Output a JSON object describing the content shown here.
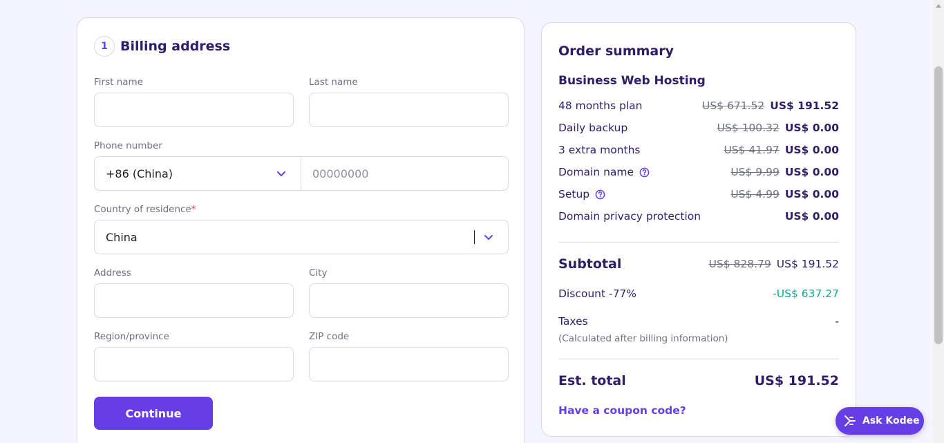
{
  "billing": {
    "step_number": "1",
    "title": "Billing address",
    "first_name": {
      "label": "First name",
      "value": ""
    },
    "last_name": {
      "label": "Last name",
      "value": ""
    },
    "phone": {
      "label": "Phone number",
      "code": "+86 (China)",
      "placeholder": "00000000"
    },
    "country": {
      "label": "Country of residence",
      "required_mark": "*",
      "value": "China"
    },
    "address": {
      "label": "Address",
      "value": ""
    },
    "city": {
      "label": "City",
      "value": ""
    },
    "region": {
      "label": "Region/province",
      "value": ""
    },
    "zip": {
      "label": "ZIP code",
      "value": ""
    },
    "continue_label": "Continue"
  },
  "summary": {
    "title": "Order summary",
    "plan_name": "Business Web Hosting",
    "items": [
      {
        "label": "48 months plan",
        "old_price": "US$ 671.52",
        "price": "US$ 191.52",
        "help": false
      },
      {
        "label": "Daily backup",
        "old_price": "US$ 100.32",
        "price": "US$ 0.00",
        "help": false
      },
      {
        "label": "3 extra months",
        "old_price": "US$ 41.97",
        "price": "US$ 0.00",
        "help": false
      },
      {
        "label": "Domain name",
        "old_price": "US$ 9.99",
        "price": "US$ 0.00",
        "help": true
      },
      {
        "label": "Setup",
        "old_price": "US$ 4.99",
        "price": "US$ 0.00",
        "help": true
      },
      {
        "label": "Domain privacy protection",
        "old_price": "",
        "price": "US$ 0.00",
        "help": false
      }
    ],
    "subtotal": {
      "label": "Subtotal",
      "old_price": "US$ 828.79",
      "price": "US$ 191.52"
    },
    "discount": {
      "label": "Discount -77%",
      "value": "-US$ 637.27"
    },
    "taxes": {
      "label": "Taxes",
      "value": "-",
      "note": "(Calculated after billing information)"
    },
    "est_total": {
      "label": "Est. total",
      "value": "US$ 191.52"
    },
    "coupon_link": "Have a coupon code?"
  },
  "assistant": {
    "label": "Ask Kodee"
  },
  "colors": {
    "brand": "#673de6",
    "text": "#2f1c6a",
    "discount": "#00b090"
  }
}
